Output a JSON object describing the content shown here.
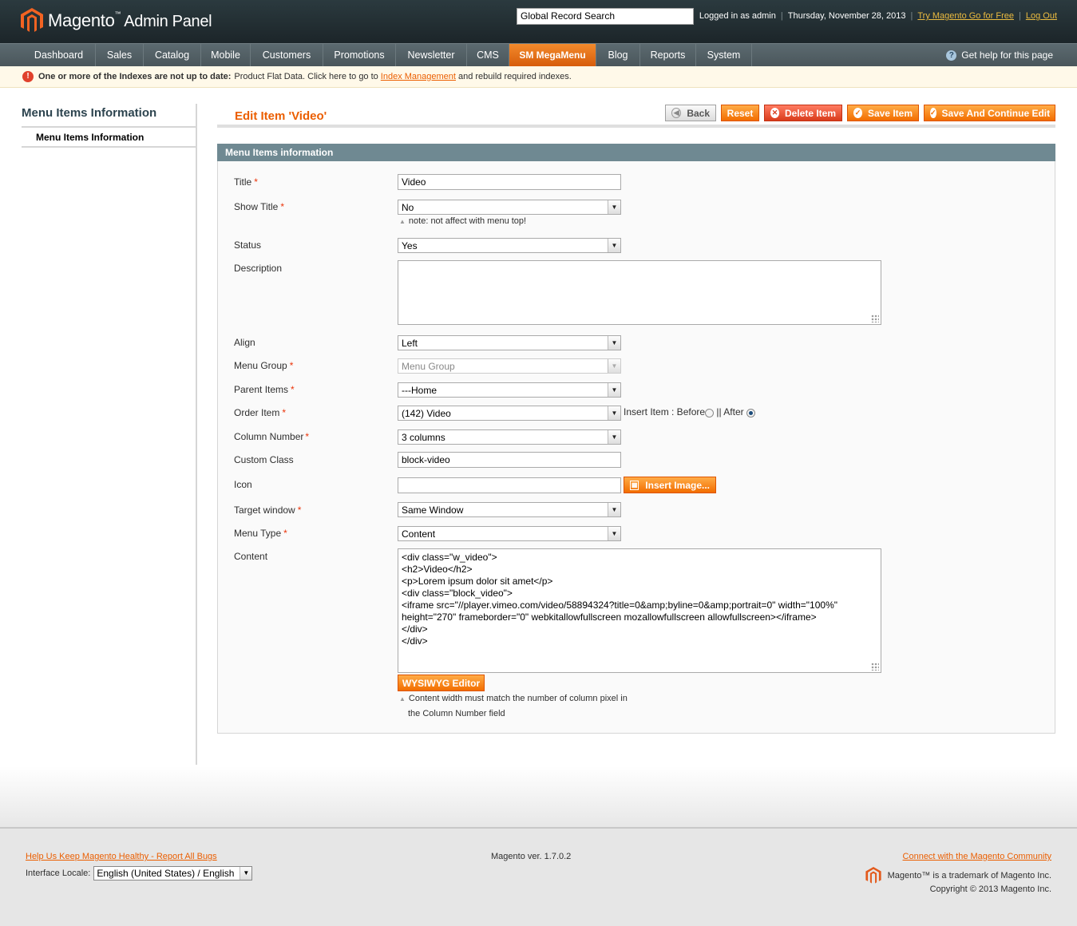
{
  "header": {
    "brand": "Magento",
    "brand_tm": "™",
    "brand_sub": "Admin Panel",
    "search_value": "Global Record Search",
    "logged_in": "Logged in as admin",
    "date": "Thursday, November 28, 2013",
    "try_link": "Try Magento Go for Free",
    "logout": "Log Out"
  },
  "nav": {
    "items": [
      "Dashboard",
      "Sales",
      "Catalog",
      "Mobile",
      "Customers",
      "Promotions",
      "Newsletter",
      "CMS",
      "SM MegaMenu",
      "Blog",
      "Reports",
      "System"
    ],
    "active": "SM MegaMenu",
    "help": "Get help for this page"
  },
  "notice": {
    "bold": "One or more of the Indexes are not up to date:",
    "text1": "Product Flat Data. Click here to go to",
    "link": "Index Management",
    "text2": "and rebuild required indexes."
  },
  "sidebar": {
    "title": "Menu Items Information",
    "tab": "Menu Items Information"
  },
  "content": {
    "title": "Edit Item 'Video'",
    "buttons": {
      "back": "Back",
      "reset": "Reset",
      "delete": "Delete Item",
      "save": "Save Item",
      "save_continue": "Save And Continue Edit"
    },
    "fieldset_title": "Menu Items information"
  },
  "form": {
    "title_label": "Title",
    "title_value": "Video",
    "show_title_label": "Show Title",
    "show_title_value": "No",
    "show_title_note": "note: not affect with menu top!",
    "status_label": "Status",
    "status_value": "Yes",
    "description_label": "Description",
    "description_value": "",
    "align_label": "Align",
    "align_value": "Left",
    "menu_group_label": "Menu Group",
    "menu_group_value": "Menu Group",
    "parent_label": "Parent Items",
    "parent_value": "---Home",
    "order_label": "Order Item",
    "order_value": "(142) Video",
    "insert_text": "Insert Item : Before",
    "insert_after": "|| After",
    "column_label": "Column Number",
    "column_value": "3 columns",
    "custom_class_label": "Custom Class",
    "custom_class_value": "block-video",
    "icon_label": "Icon",
    "icon_value": "",
    "insert_image": "Insert Image...",
    "target_label": "Target window",
    "target_value": "Same Window",
    "menu_type_label": "Menu Type",
    "menu_type_value": "Content",
    "content_label": "Content",
    "content_value": "<div class=\"w_video\">\n<h2>Video</h2>\n<p>Lorem ipsum dolor sit amet</p>\n<div class=\"block_video\">\n<iframe src=\"//player.vimeo.com/video/58894324?title=0&amp;byline=0&amp;portrait=0\" width=\"100%\"\nheight=\"270\" frameborder=\"0\" webkitallowfullscreen mozallowfullscreen allowfullscreen></iframe>\n</div>\n</div>",
    "wysiwyg": "WYSIWYG Editor",
    "content_note_1": "Content width must match the number of column pixel in",
    "content_note_2": "the Column Number field",
    "required_mark": "*"
  },
  "footer": {
    "bugs_link": "Help Us Keep Magento Healthy - Report All Bugs",
    "locale_label": "Interface Locale:",
    "locale_value": "English (United States) / English",
    "version": "Magento ver. 1.7.0.2",
    "community": "Connect with the Magento Community",
    "trademark": "Magento™ is a trademark of Magento Inc.",
    "copyright": "Copyright © 2013 Magento Inc."
  },
  "colors": {
    "accent": "#eb5e00",
    "header_bg": "#1c2529",
    "nav_bg": "#4a565b",
    "fieldset_head": "#6f8992"
  }
}
